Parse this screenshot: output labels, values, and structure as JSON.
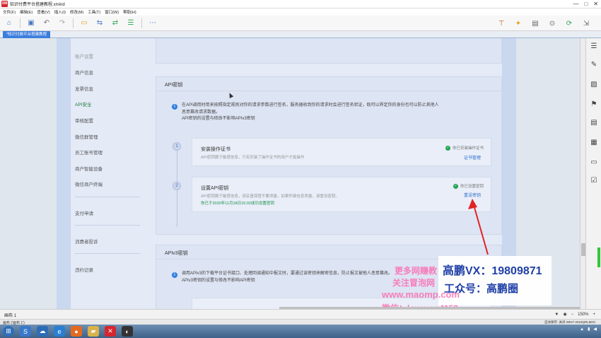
{
  "window": {
    "app_badge": "XM",
    "title": "知识付费平台搭建教程.xmind",
    "controls": [
      "—",
      "□",
      "✕"
    ]
  },
  "menu": [
    "文件(F)",
    "编辑(E)",
    "查看(V)",
    "插入(I)",
    "修改(M)",
    "工具(T)",
    "窗口(W)",
    "帮助(H)"
  ],
  "doc_tab": "*知识付费平台搭建教程",
  "sidebar": {
    "items": [
      {
        "label": "账户设置",
        "state": "muted"
      },
      {
        "label": "商户信息",
        "state": "normal"
      },
      {
        "label": "发票信息",
        "state": "normal"
      },
      {
        "label": "API安全",
        "state": "active"
      },
      {
        "label": "审核配置",
        "state": "normal"
      },
      {
        "label": "微信群管理",
        "state": "normal"
      },
      {
        "label": "员工账号管理",
        "state": "normal"
      },
      {
        "label": "商户智能设备",
        "state": "normal"
      },
      {
        "label": "微信商户终端",
        "state": "normal"
      },
      {
        "label": "支付申请",
        "state": "normal"
      },
      {
        "label": "消费者投诉",
        "state": "normal"
      },
      {
        "label": "违约记录",
        "state": "normal"
      }
    ]
  },
  "api_card": {
    "title": "API密钥",
    "info_line1": "在API调用时用来按照指定规则对你的请求参数进行签名，服务器收到你的请求时会进行签名验证，既可以界定你的身份也可以防止其他人",
    "info_line2": "恶意篡改请求数据。",
    "info_line3": "API密钥的设置与修改不影响APIv3密钥",
    "steps": [
      {
        "num": "1",
        "title": "安装操作证书",
        "desc": "API密钥属于敏感信息，只有安装了操作证书的用户才能操作",
        "status": "你已安装操作证书",
        "link": "证书管理"
      },
      {
        "num": "2",
        "title": "设置API密钥",
        "desc": "API密钥属于敏感信息，请妥善保管不要泄露，如果怀疑信息泄露，请重设密钥。",
        "note": "你已于2020年11月18日15:02成功设置密钥",
        "status": "你已设置密钥",
        "link": "重设密钥"
      }
    ]
  },
  "apiv3_card": {
    "title": "APIv3密钥",
    "info_line1": "调用APIv3的下载平台证书接口、处理回调通知中报文时，要通过该密钥来解密信息，防止报文被他人恶意篡改。",
    "info_line2": "APIv3密钥的设置与修改不影响API密钥"
  },
  "watermark": {
    "vx": "高鹏VX：19809871",
    "gzh": "工众号：高鹏圈",
    "pink1": "更多网赚教",
    "pink2": "关注冒泡网",
    "pink3": "www.maomp.com",
    "pink4": "微信：loveyou4153"
  },
  "sheetbar": {
    "tab": "画布 1",
    "zoom": "150%"
  },
  "statusbar": {
    "left": "画布 ('画布 1')",
    "right": "自动保存: 关闭   WIN7-2019QRL8DO"
  },
  "colors": {
    "accent_green": "#1b8e4a",
    "link_blue": "#2f6fd1",
    "info_blue": "#2f7ee0",
    "arrow_red": "#e02424"
  }
}
